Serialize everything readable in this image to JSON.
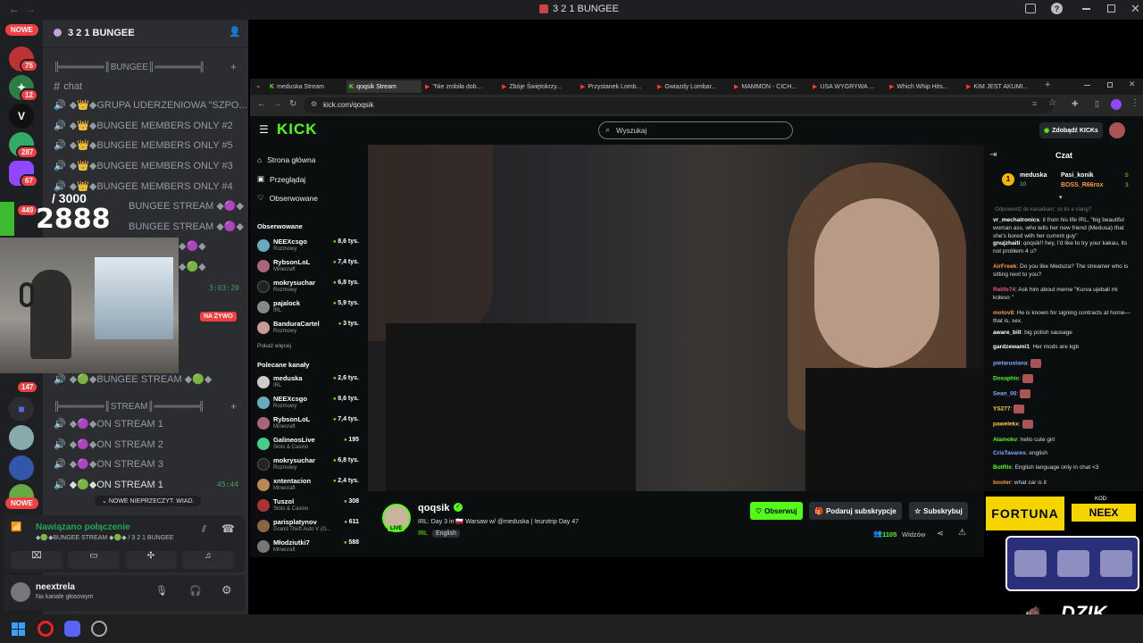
{
  "discord": {
    "window_title": "3 2 1 BUNGEE",
    "new_badge": "NOWE",
    "new_badge2": "NOWE",
    "server_name": "3 2 1 BUNGEE",
    "rail_badges": [
      "75",
      "12",
      "287",
      "67",
      "449",
      "147"
    ],
    "rail_letter": "V",
    "categories": [
      "╠═══════║BUNGEE║═══════╣",
      "╠═══════║STREAM║═══════╣"
    ],
    "channels": [
      {
        "name": "chat",
        "icon": "hash-icon"
      },
      {
        "name": "◆👑◆GRUPA UDERZENIOWA \"SZPO...",
        "icon": "speaker-icon"
      },
      {
        "name": "◆👑◆BUNGEE MEMBERS ONLY #2",
        "icon": "speaker-icon"
      },
      {
        "name": "◆👑◆BUNGEE MEMBERS ONLY #5",
        "icon": "speaker-icon"
      },
      {
        "name": "◆👑◆BUNGEE MEMBERS ONLY #3",
        "icon": "speaker-icon"
      },
      {
        "name": "◆👑◆BUNGEE MEMBERS ONLY #4",
        "icon": "speaker-icon"
      },
      {
        "name": "BUNGEE STREAM ◆🟣◆",
        "icon": "speaker-icon"
      },
      {
        "name": "BUNGEE STREAM ◆🟣◆",
        "icon": "speaker-icon"
      },
      {
        "name": "◆🟣◆",
        "icon": "speaker-icon"
      },
      {
        "name": "◆🟢◆",
        "icon": "speaker-icon"
      },
      {
        "name": "◆🟢◆BUNGEE STREAM ◆🟢◆",
        "icon": "speaker-icon"
      }
    ],
    "stream_channels": [
      "◆🟣◆ON STREAM 1",
      "◆🟣◆ON STREAM 2",
      "◆🟣◆ON STREAM 3",
      "◆🟢◆ON STREAM 1"
    ],
    "timer1": "3:03:20",
    "timer2": "45:44",
    "live_badge": "NA ŻYWO",
    "unread": "NOWE NIEPRZECZYT. WIAD.",
    "voice_status": "Nawiązano połączenie",
    "voice_channel": "◆🟢◆BUNGEE STREAM ◆🟢◆ / 3 2 1 BUNGEE",
    "user_name": "neextrela",
    "user_status": "Na kanale głosowym"
  },
  "overlay": {
    "counter_total": "/ 3000",
    "counter_value": "2888",
    "fortuna": "FORTUNA",
    "kod_label": "KOD:",
    "kod_value": "NEEX",
    "dzik": "DZIK"
  },
  "browser": {
    "tabs": [
      "meduska Stream",
      "qoqsik Stream",
      "\"Nie zrobiła dob...",
      "Zbóje Świętokrzy...",
      "Przystanek Lomb...",
      "Gwiazdy Lombar...",
      "MAMMON - CICH...",
      "USA WYGRYWA ...",
      "Which Whip Hits...",
      "KIM JEST AKUMI..."
    ],
    "url": "kick.com/qoqsik"
  },
  "kick": {
    "search_placeholder": "Wyszukaj",
    "get_kicks": "Zdobądź KICKs",
    "nav": [
      "Strona główna",
      "Przeglądaj",
      "Obserwowane"
    ],
    "followed_title": "Obserwowane",
    "followed": [
      {
        "name": "NEEXcsgo",
        "cat": "Rozmowy",
        "viewers": "8,6 tys."
      },
      {
        "name": "RybsonLoL",
        "cat": "Minecraft",
        "viewers": "7,4 tys."
      },
      {
        "name": "mokrysuchar",
        "cat": "Rozmowy",
        "viewers": "6,8 tys."
      },
      {
        "name": "pajalock",
        "cat": "IRL",
        "viewers": "5,9 tys."
      },
      {
        "name": "BanduraCartel",
        "cat": "Rozmowy",
        "viewers": "3 tys."
      }
    ],
    "show_more": "Pokaż więcej",
    "recommended_title": "Polecane kanały",
    "recommended": [
      {
        "name": "meduska",
        "cat": "IRL",
        "viewers": "2,6 tys."
      },
      {
        "name": "NEEXcsgo",
        "cat": "Rozmowy",
        "viewers": "8,6 tys."
      },
      {
        "name": "RybsonLoL",
        "cat": "Minecraft",
        "viewers": "7,4 tys."
      },
      {
        "name": "GalineosLive",
        "cat": "Slots & Casino",
        "viewers": "195"
      },
      {
        "name": "mokrysuchar",
        "cat": "Rozmowy",
        "viewers": "6,8 tys."
      },
      {
        "name": "xntentacion",
        "cat": "Minecraft",
        "viewers": "2,4 tys."
      },
      {
        "name": "Tuszol",
        "cat": "Slots & Casino",
        "viewers": "308"
      },
      {
        "name": "parisplatynov",
        "cat": "Grand Theft Auto V (G...",
        "viewers": "611"
      },
      {
        "name": "Młodziutki7",
        "cat": "Minecraft",
        "viewers": "588"
      }
    ],
    "streamer": "qoqsik",
    "live_tag": "LIVE",
    "stream_title": "IRL: Day 3 in 🇵🇱 Warsaw w/ @meduska | !eurotrip Day 47",
    "category": "IRL",
    "language": "English",
    "follow": "Obserwuj",
    "gift_sub": "Podaruj subskrypcje",
    "subscribe": "Subskrybuj",
    "viewers": "1105",
    "viewers_label": "Widzów",
    "chat_title": "Czat",
    "pinned": [
      {
        "name": "meduska",
        "val": "10"
      },
      {
        "name": "Pasi_konik",
        "val": "5"
      },
      {
        "name": "BOSS_R66rox",
        "val": "3"
      }
    ],
    "reply_hint": "Odpowiedź do kanadianr: so its a slang?",
    "messages": [
      {
        "user": "vr_mechatronics",
        "color": "#ffffff",
        "text": "it from his life IRL, \"big beautiful woman ass, who tells her new friend (Medusa) that she's bored with her current guy\""
      },
      {
        "user": "gnujzhaiti",
        "color": "#ffffff",
        "text": "qoqsik!! hey, I'd like to try your kakau, its not problem 4 u?"
      },
      {
        "user": "AirFreek",
        "color": "#ff9a3c",
        "text": "Do you like Meduza? The streamer who is sitting next to you?"
      },
      {
        "user": "Relife74",
        "color": "#e05a8a",
        "text": "Ask him about meme \"Kurva ujebali mi koleso \""
      },
      {
        "user": "motov8",
        "color": "#ff9a3c",
        "text": "He is known for signing contracts at home—that is, sex."
      },
      {
        "user": "aware_bill",
        "color": "#ffffff",
        "text": "big polish sausage"
      },
      {
        "user": "gardzewami1",
        "color": "#ffffff",
        "text": "Her mods are kgb"
      },
      {
        "user": "pietaruslana",
        "color": "#7fb3ff",
        "text": ""
      },
      {
        "user": "Dosaphic",
        "color": "#53fc18",
        "text": ""
      },
      {
        "user": "Sean_00",
        "color": "#7fb3ff",
        "text": ""
      },
      {
        "user": "YS277",
        "color": "#ffd23c",
        "text": ""
      },
      {
        "user": "pawelekx",
        "color": "#ffd23c",
        "text": ""
      },
      {
        "user": "Alamokv",
        "color": "#53fc18",
        "text": "hello cute girl"
      },
      {
        "user": "CrisTavares",
        "color": "#7fb3ff",
        "text": "english"
      },
      {
        "user": "BotRix",
        "color": "#53fc18",
        "text": "English language only in chat <3"
      },
      {
        "user": "booter",
        "color": "#ff9a3c",
        "text": "what car is it"
      }
    ]
  },
  "colors": {
    "kick_green": "#53fc18",
    "discord_red": "#f23f43",
    "discord_green": "#23a55a"
  }
}
